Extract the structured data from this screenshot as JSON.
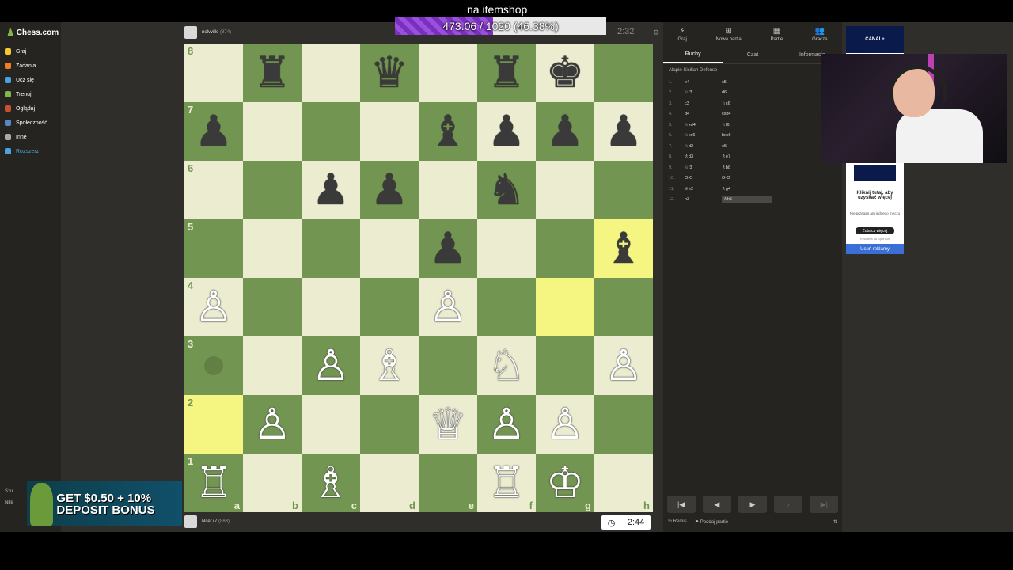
{
  "overlay": {
    "title": "na itemshop",
    "goal_text": "473.06 / 1020 (46.38%)",
    "goal_progress": 0.4638,
    "promo_text": "GET $0.50 + 10% DEPOSIT BONUS"
  },
  "sidebar": {
    "logo": "Chess.com",
    "items": [
      {
        "label": "Graj",
        "color": "#f7c631"
      },
      {
        "label": "Zadania",
        "color": "#f57d1f"
      },
      {
        "label": "Ucz się",
        "color": "#4aa3df"
      },
      {
        "label": "Trenuj",
        "color": "#81b64c"
      },
      {
        "label": "Oglądaj",
        "color": "#c94f2f"
      },
      {
        "label": "Społeczność",
        "color": "#5a86c2"
      },
      {
        "label": "Inne",
        "color": "#aaa"
      },
      {
        "label": "Rozszerz",
        "color": "#4aa3df"
      }
    ],
    "bottom_a": "Szu",
    "bottom_b": "Nite"
  },
  "top_player": {
    "name": "nolvville",
    "rating": "(874)",
    "clock": "2:32"
  },
  "bottom_player": {
    "name": "Niter77",
    "rating": "(883)",
    "clock": "2:44"
  },
  "board": {
    "ranks": [
      "8",
      "7",
      "6",
      "5",
      "4",
      "3",
      "2",
      "1"
    ],
    "files": [
      "a",
      "b",
      "c",
      "d",
      "e",
      "f",
      "g",
      "h"
    ],
    "rows": [
      [
        "",
        "♜",
        "",
        "♛",
        "",
        "♜",
        "♚",
        ""
      ],
      [
        "♟",
        "",
        "",
        "",
        "♝",
        "♟",
        "♟",
        "♟"
      ],
      [
        "",
        "",
        "♟",
        "♟",
        "",
        "♞",
        "",
        ""
      ],
      [
        "",
        "",
        "",
        "",
        "♟",
        "",
        "",
        "♝"
      ],
      [
        "♙",
        "",
        "",
        "",
        "♙",
        "",
        "",
        ""
      ],
      [
        "",
        "",
        "♙",
        "♗",
        "",
        "♘",
        "",
        "♙"
      ],
      [
        "",
        "♙",
        "",
        "",
        "♕",
        "♙",
        "♙",
        ""
      ],
      [
        "♖",
        "",
        "♗",
        "",
        "",
        "♖",
        "♔",
        ""
      ]
    ],
    "highlights": [
      "h5",
      "g4",
      "a2"
    ],
    "move_hint": "a3"
  },
  "panel": {
    "tabs": [
      "Graj",
      "Nowa partia",
      "Partie",
      "Gracze"
    ],
    "subtabs": [
      "Ruchy",
      "Czat",
      "Informacje"
    ],
    "opening": "Alapin Sicilian Defense",
    "moves": [
      {
        "n": "1.",
        "w": "e4",
        "b": "c5"
      },
      {
        "n": "2.",
        "w": "♘f3",
        "b": "d6"
      },
      {
        "n": "3.",
        "w": "c3",
        "b": "♘c6"
      },
      {
        "n": "4.",
        "w": "d4",
        "b": "cxd4"
      },
      {
        "n": "5.",
        "w": "♘xd4",
        "b": "♘f6"
      },
      {
        "n": "6.",
        "w": "♘xc6",
        "b": "bxc6"
      },
      {
        "n": "7.",
        "w": "♘d2",
        "b": "e5"
      },
      {
        "n": "8.",
        "w": "♗d3",
        "b": "♗e7"
      },
      {
        "n": "9.",
        "w": "♘f3",
        "b": "♗b8"
      },
      {
        "n": "10.",
        "w": "O-O",
        "b": "O-O"
      },
      {
        "n": "11.",
        "w": "♕e2",
        "b": "♗g4"
      },
      {
        "n": "12.",
        "w": "h3",
        "b": "♗h5"
      }
    ],
    "draw": "Remis",
    "resign": "Poddaj partię"
  },
  "ad": {
    "brand": "CANAL+",
    "headline": "Kliknij tutaj, aby uzyskać więcej",
    "small": "Nie przegap ani jednego meczu",
    "button": "Zobacz więcej",
    "sponsor": "Reklama od Sponsor",
    "remove": "Usuń reklamy"
  }
}
